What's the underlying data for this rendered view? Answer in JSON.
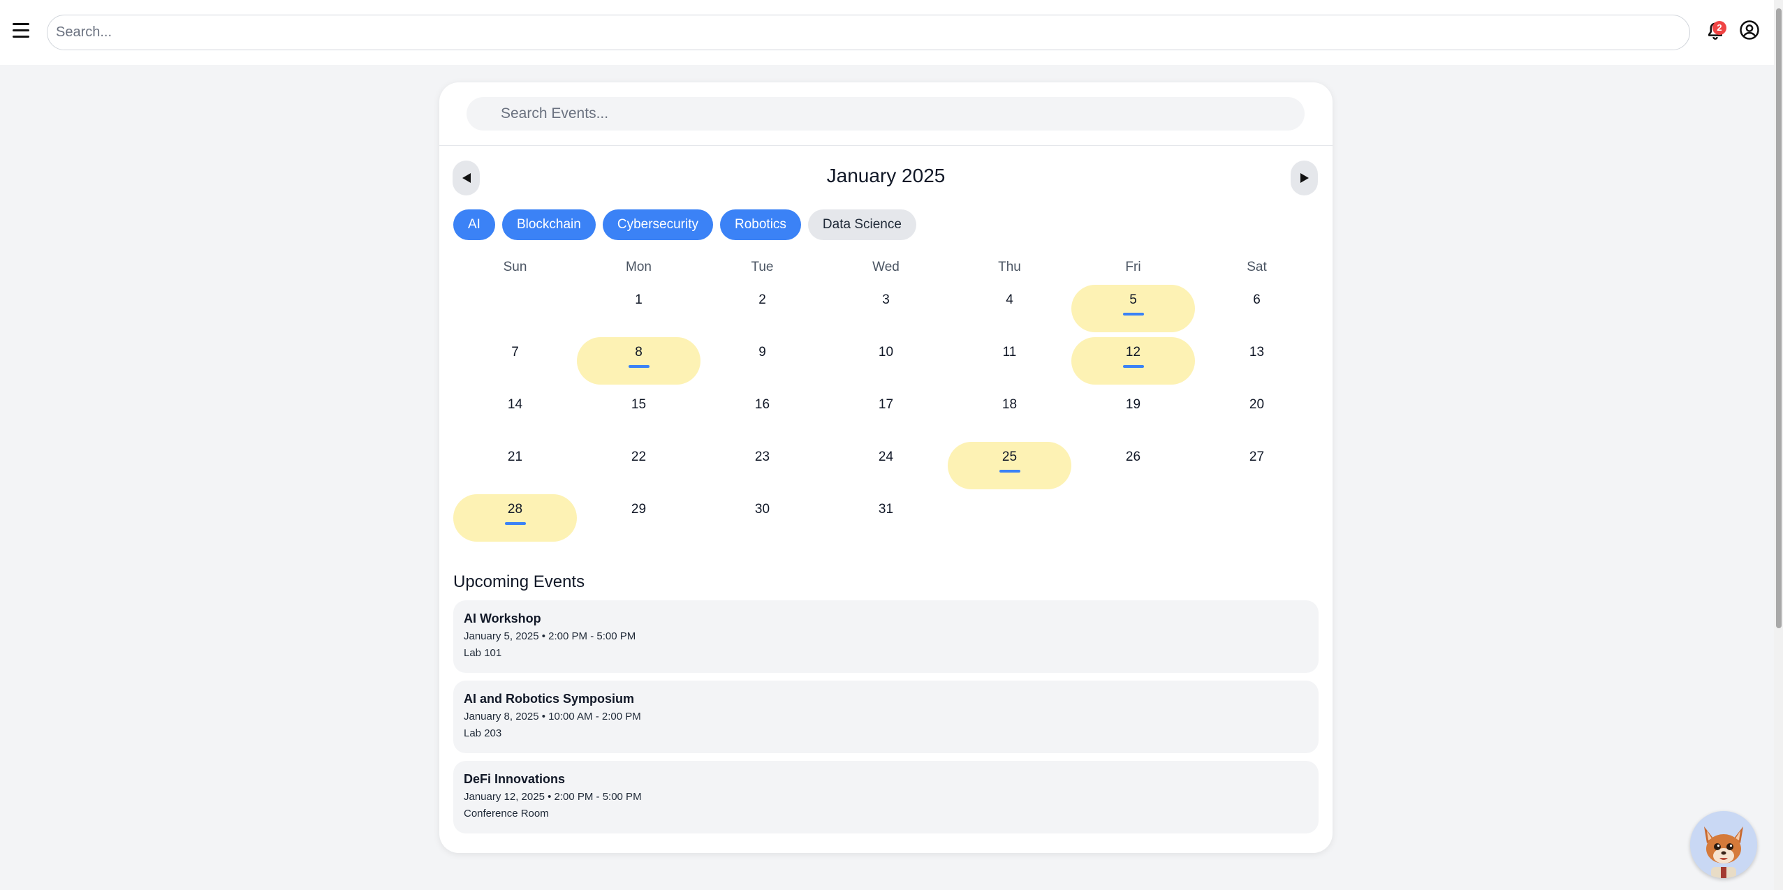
{
  "topbar": {
    "search_placeholder": "Search...",
    "notification_count": "2"
  },
  "events_search": {
    "placeholder": "Search Events..."
  },
  "calendar": {
    "month_title": "January 2025",
    "weekdays": [
      "Sun",
      "Mon",
      "Tue",
      "Wed",
      "Thu",
      "Fri",
      "Sat"
    ],
    "days": [
      "",
      "1",
      "2",
      "3",
      "4",
      "5",
      "6",
      "7",
      "8",
      "9",
      "10",
      "11",
      "12",
      "13",
      "14",
      "15",
      "16",
      "17",
      "18",
      "19",
      "20",
      "21",
      "22",
      "23",
      "24",
      "25",
      "26",
      "27",
      "28",
      "29",
      "30",
      "31"
    ],
    "event_days": [
      "5",
      "8",
      "12",
      "25",
      "28"
    ]
  },
  "filters": [
    {
      "label": "AI",
      "active": true
    },
    {
      "label": "Blockchain",
      "active": true
    },
    {
      "label": "Cybersecurity",
      "active": true
    },
    {
      "label": "Robotics",
      "active": true
    },
    {
      "label": "Data Science",
      "active": false
    }
  ],
  "upcoming": {
    "title": "Upcoming Events",
    "events": [
      {
        "name": "AI Workshop",
        "when": "January 5, 2025 • 2:00 PM - 5:00 PM",
        "where": "Lab 101"
      },
      {
        "name": "AI and Robotics Symposium",
        "when": "January 8, 2025 • 10:00 AM - 2:00 PM",
        "where": "Lab 203"
      },
      {
        "name": "DeFi Innovations",
        "when": "January 12, 2025 • 2:00 PM - 5:00 PM",
        "where": "Conference Room"
      }
    ]
  },
  "colors": {
    "accent": "#3b82f6",
    "event_day_highlight": "#fdf2b4",
    "badge": "#ef4444",
    "page_background": "#f3f4f6"
  }
}
